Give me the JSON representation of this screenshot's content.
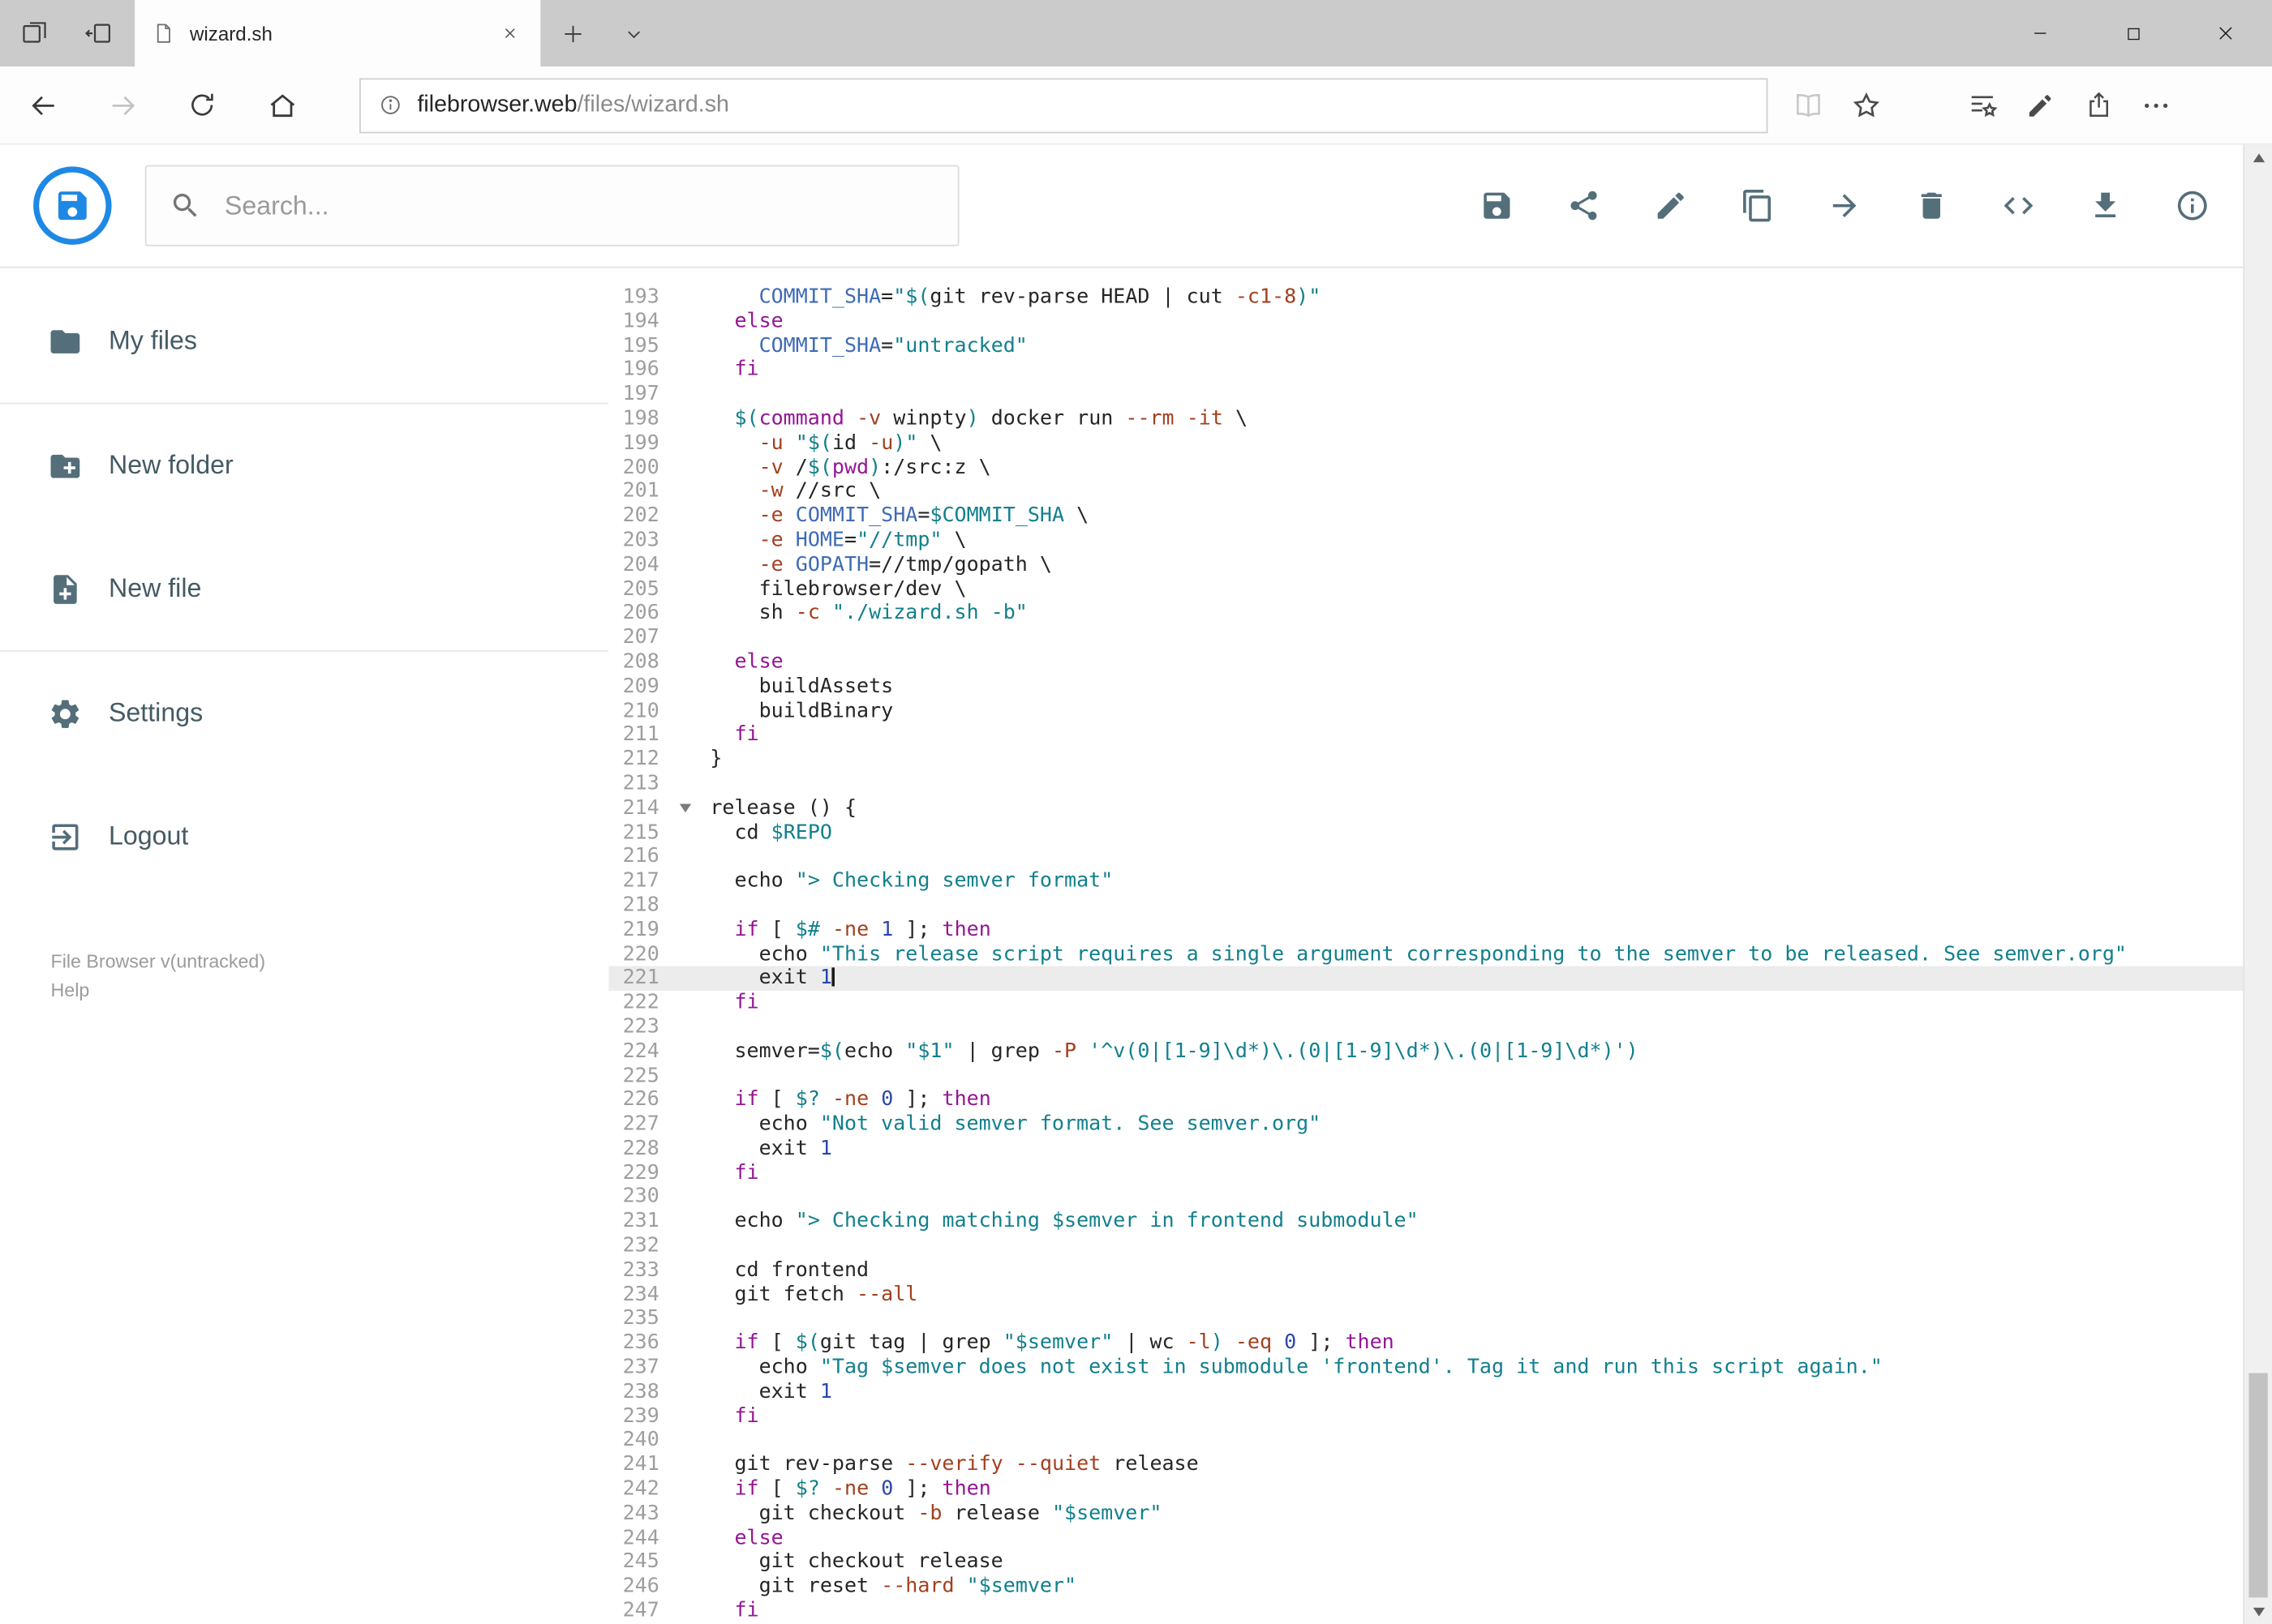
{
  "browser": {
    "tab_title": "wizard.sh",
    "url": {
      "host": "filebrowser.web",
      "path": "/files/wizard.sh"
    }
  },
  "app": {
    "search_placeholder": "Search...",
    "toolbar_icons": [
      "save",
      "share",
      "rename",
      "copy",
      "move",
      "delete",
      "code",
      "download",
      "info"
    ],
    "sidebar": {
      "items": [
        {
          "id": "my-files",
          "icon": "folder",
          "label": "My files",
          "divider_after": true
        },
        {
          "id": "new-folder",
          "icon": "new-folder",
          "label": "New folder",
          "divider_after": false
        },
        {
          "id": "new-file",
          "icon": "new-file",
          "label": "New file",
          "divider_after": true
        },
        {
          "id": "settings",
          "icon": "settings",
          "label": "Settings",
          "divider_after": false
        },
        {
          "id": "logout",
          "icon": "logout",
          "label": "Logout",
          "divider_after": false
        }
      ],
      "footer_version": "File Browser v(untracked)",
      "footer_help": "Help"
    },
    "accent_color": "#1e88e5",
    "icon_color": "#546e7a"
  },
  "editor": {
    "active_line": 221,
    "fold_line": 214,
    "first_line": 193,
    "last_line": 247,
    "colors": {
      "d": "#262626",
      "k": "#941694",
      "s": "#12808d",
      "i": "#3f6bb6",
      "f": "#a3401f",
      "n": "#2b47ad"
    },
    "lines": [
      {
        "n": 193,
        "t": [
          [
            "d",
            "    "
          ],
          [
            "i",
            "COMMIT_SHA"
          ],
          [
            "d",
            "="
          ],
          [
            "s",
            "\"$("
          ],
          [
            "d",
            "git rev-parse HEAD | cut "
          ],
          [
            "f",
            "-c1-8"
          ],
          [
            "s",
            ")\""
          ]
        ]
      },
      {
        "n": 194,
        "t": [
          [
            "d",
            "  "
          ],
          [
            "k",
            "else"
          ]
        ]
      },
      {
        "n": 195,
        "t": [
          [
            "d",
            "    "
          ],
          [
            "i",
            "COMMIT_SHA"
          ],
          [
            "d",
            "="
          ],
          [
            "s",
            "\"untracked\""
          ]
        ]
      },
      {
        "n": 196,
        "t": [
          [
            "d",
            "  "
          ],
          [
            "k",
            "fi"
          ]
        ]
      },
      {
        "n": 197,
        "t": []
      },
      {
        "n": 198,
        "t": [
          [
            "d",
            "  "
          ],
          [
            "s",
            "$("
          ],
          [
            "k",
            "command"
          ],
          [
            "d",
            " "
          ],
          [
            "f",
            "-v"
          ],
          [
            "d",
            " winpty"
          ],
          [
            "s",
            ")"
          ],
          [
            "d",
            " docker run "
          ],
          [
            "f",
            "--rm"
          ],
          [
            "d",
            " "
          ],
          [
            "f",
            "-it"
          ],
          [
            "d",
            " \\"
          ]
        ]
      },
      {
        "n": 199,
        "t": [
          [
            "d",
            "    "
          ],
          [
            "f",
            "-u"
          ],
          [
            "d",
            " "
          ],
          [
            "s",
            "\"$("
          ],
          [
            "d",
            "id "
          ],
          [
            "f",
            "-u"
          ],
          [
            "s",
            ")\""
          ],
          [
            "d",
            " \\"
          ]
        ]
      },
      {
        "n": 200,
        "t": [
          [
            "d",
            "    "
          ],
          [
            "f",
            "-v"
          ],
          [
            "d",
            " /"
          ],
          [
            "s",
            "$("
          ],
          [
            "k",
            "pwd"
          ],
          [
            "s",
            ")"
          ],
          [
            "d",
            ":/src:z \\"
          ]
        ]
      },
      {
        "n": 201,
        "t": [
          [
            "d",
            "    "
          ],
          [
            "f",
            "-w"
          ],
          [
            "d",
            " //src \\"
          ]
        ]
      },
      {
        "n": 202,
        "t": [
          [
            "d",
            "    "
          ],
          [
            "f",
            "-e"
          ],
          [
            "d",
            " "
          ],
          [
            "i",
            "COMMIT_SHA"
          ],
          [
            "d",
            "="
          ],
          [
            "s",
            "$COMMIT_SHA"
          ],
          [
            "d",
            " \\"
          ]
        ]
      },
      {
        "n": 203,
        "t": [
          [
            "d",
            "    "
          ],
          [
            "f",
            "-e"
          ],
          [
            "d",
            " "
          ],
          [
            "i",
            "HOME"
          ],
          [
            "d",
            "="
          ],
          [
            "s",
            "\"//tmp\""
          ],
          [
            "d",
            " \\"
          ]
        ]
      },
      {
        "n": 204,
        "t": [
          [
            "d",
            "    "
          ],
          [
            "f",
            "-e"
          ],
          [
            "d",
            " "
          ],
          [
            "i",
            "GOPATH"
          ],
          [
            "d",
            "=//tmp/gopath \\"
          ]
        ]
      },
      {
        "n": 205,
        "t": [
          [
            "d",
            "    filebrowser/dev \\"
          ]
        ]
      },
      {
        "n": 206,
        "t": [
          [
            "d",
            "    sh "
          ],
          [
            "f",
            "-c"
          ],
          [
            "d",
            " "
          ],
          [
            "s",
            "\"./wizard.sh -b\""
          ]
        ]
      },
      {
        "n": 207,
        "t": []
      },
      {
        "n": 208,
        "t": [
          [
            "d",
            "  "
          ],
          [
            "k",
            "else"
          ]
        ]
      },
      {
        "n": 209,
        "t": [
          [
            "d",
            "    buildAssets"
          ]
        ]
      },
      {
        "n": 210,
        "t": [
          [
            "d",
            "    buildBinary"
          ]
        ]
      },
      {
        "n": 211,
        "t": [
          [
            "d",
            "  "
          ],
          [
            "k",
            "fi"
          ]
        ]
      },
      {
        "n": 212,
        "t": [
          [
            "d",
            "}"
          ]
        ]
      },
      {
        "n": 213,
        "t": []
      },
      {
        "n": 214,
        "t": [
          [
            "d",
            "release () {"
          ]
        ]
      },
      {
        "n": 215,
        "t": [
          [
            "d",
            "  cd "
          ],
          [
            "s",
            "$REPO"
          ]
        ]
      },
      {
        "n": 216,
        "t": []
      },
      {
        "n": 217,
        "t": [
          [
            "d",
            "  echo "
          ],
          [
            "s",
            "\"> Checking semver format\""
          ]
        ]
      },
      {
        "n": 218,
        "t": []
      },
      {
        "n": 219,
        "t": [
          [
            "d",
            "  "
          ],
          [
            "k",
            "if"
          ],
          [
            "d",
            " [ "
          ],
          [
            "s",
            "$#"
          ],
          [
            "d",
            " "
          ],
          [
            "f",
            "-ne"
          ],
          [
            "d",
            " "
          ],
          [
            "n2",
            "1"
          ],
          [
            "d",
            " ]; "
          ],
          [
            "k",
            "then"
          ]
        ]
      },
      {
        "n": 220,
        "t": [
          [
            "d",
            "    echo "
          ],
          [
            "s",
            "\"This release script requires a single argument corresponding to the semver to be released. See semver.org\""
          ]
        ]
      },
      {
        "n": 221,
        "t": [
          [
            "d",
            "    exit "
          ],
          [
            "n2",
            "1"
          ]
        ]
      },
      {
        "n": 222,
        "t": [
          [
            "d",
            "  "
          ],
          [
            "k",
            "fi"
          ]
        ]
      },
      {
        "n": 223,
        "t": []
      },
      {
        "n": 224,
        "t": [
          [
            "d",
            "  semver="
          ],
          [
            "s",
            "$("
          ],
          [
            "d",
            "echo "
          ],
          [
            "s",
            "\"$1\""
          ],
          [
            "d",
            " | grep "
          ],
          [
            "f",
            "-P"
          ],
          [
            "d",
            " "
          ],
          [
            "s",
            "'^v(0|[1-9]\\d*)\\.(0|[1-9]\\d*)\\.(0|[1-9]\\d*)')"
          ]
        ]
      },
      {
        "n": 225,
        "t": []
      },
      {
        "n": 226,
        "t": [
          [
            "d",
            "  "
          ],
          [
            "k",
            "if"
          ],
          [
            "d",
            " [ "
          ],
          [
            "s",
            "$?"
          ],
          [
            "d",
            " "
          ],
          [
            "f",
            "-ne"
          ],
          [
            "d",
            " "
          ],
          [
            "n2",
            "0"
          ],
          [
            "d",
            " ]; "
          ],
          [
            "k",
            "then"
          ]
        ]
      },
      {
        "n": 227,
        "t": [
          [
            "d",
            "    echo "
          ],
          [
            "s",
            "\"Not valid semver format. See semver.org\""
          ]
        ]
      },
      {
        "n": 228,
        "t": [
          [
            "d",
            "    exit "
          ],
          [
            "n2",
            "1"
          ]
        ]
      },
      {
        "n": 229,
        "t": [
          [
            "d",
            "  "
          ],
          [
            "k",
            "fi"
          ]
        ]
      },
      {
        "n": 230,
        "t": []
      },
      {
        "n": 231,
        "t": [
          [
            "d",
            "  echo "
          ],
          [
            "s",
            "\"> Checking matching $semver in frontend submodule\""
          ]
        ]
      },
      {
        "n": 232,
        "t": []
      },
      {
        "n": 233,
        "t": [
          [
            "d",
            "  cd frontend"
          ]
        ]
      },
      {
        "n": 234,
        "t": [
          [
            "d",
            "  git fetch "
          ],
          [
            "f",
            "--all"
          ]
        ]
      },
      {
        "n": 235,
        "t": []
      },
      {
        "n": 236,
        "t": [
          [
            "d",
            "  "
          ],
          [
            "k",
            "if"
          ],
          [
            "d",
            " [ "
          ],
          [
            "s",
            "$("
          ],
          [
            "d",
            "git tag | grep "
          ],
          [
            "s",
            "\"$semver\""
          ],
          [
            "d",
            " | wc "
          ],
          [
            "f",
            "-l"
          ],
          [
            "s",
            ")"
          ],
          [
            "d",
            " "
          ],
          [
            "f",
            "-eq"
          ],
          [
            "d",
            " "
          ],
          [
            "n2",
            "0"
          ],
          [
            "d",
            " ]; "
          ],
          [
            "k",
            "then"
          ]
        ]
      },
      {
        "n": 237,
        "t": [
          [
            "d",
            "    echo "
          ],
          [
            "s",
            "\"Tag $semver does not exist in submodule 'frontend'. Tag it and run this script again.\""
          ]
        ]
      },
      {
        "n": 238,
        "t": [
          [
            "d",
            "    exit "
          ],
          [
            "n2",
            "1"
          ]
        ]
      },
      {
        "n": 239,
        "t": [
          [
            "d",
            "  "
          ],
          [
            "k",
            "fi"
          ]
        ]
      },
      {
        "n": 240,
        "t": []
      },
      {
        "n": 241,
        "t": [
          [
            "d",
            "  git rev-parse "
          ],
          [
            "f",
            "--verify"
          ],
          [
            "d",
            " "
          ],
          [
            "f",
            "--quiet"
          ],
          [
            "d",
            " release"
          ]
        ]
      },
      {
        "n": 242,
        "t": [
          [
            "d",
            "  "
          ],
          [
            "k",
            "if"
          ],
          [
            "d",
            " [ "
          ],
          [
            "s",
            "$?"
          ],
          [
            "d",
            " "
          ],
          [
            "f",
            "-ne"
          ],
          [
            "d",
            " "
          ],
          [
            "n2",
            "0"
          ],
          [
            "d",
            " ]; "
          ],
          [
            "k",
            "then"
          ]
        ]
      },
      {
        "n": 243,
        "t": [
          [
            "d",
            "    git checkout "
          ],
          [
            "f",
            "-b"
          ],
          [
            "d",
            " release "
          ],
          [
            "s",
            "\"$semver\""
          ]
        ]
      },
      {
        "n": 244,
        "t": [
          [
            "d",
            "  "
          ],
          [
            "k",
            "else"
          ]
        ]
      },
      {
        "n": 245,
        "t": [
          [
            "d",
            "    git checkout release"
          ]
        ]
      },
      {
        "n": 246,
        "t": [
          [
            "d",
            "    git reset "
          ],
          [
            "f",
            "--hard"
          ],
          [
            "d",
            " "
          ],
          [
            "s",
            "\"$semver\""
          ]
        ]
      },
      {
        "n": 247,
        "t": [
          [
            "d",
            "  "
          ],
          [
            "k",
            "fi"
          ]
        ]
      }
    ]
  }
}
